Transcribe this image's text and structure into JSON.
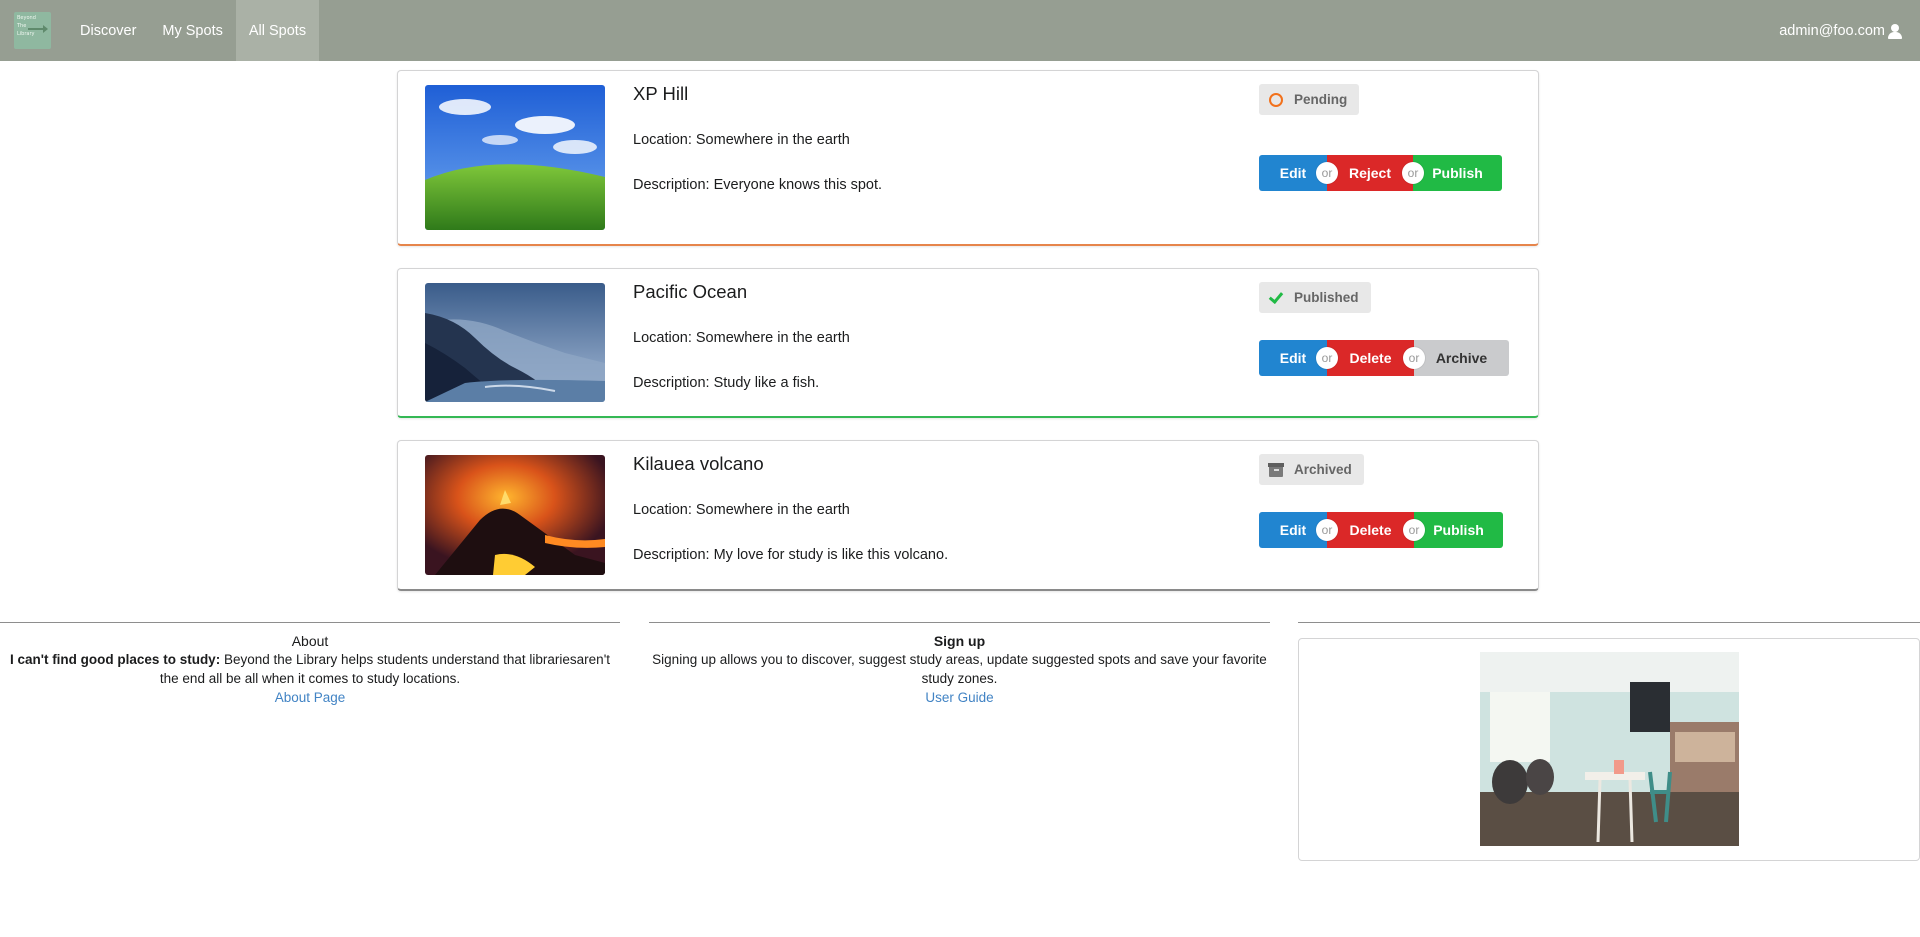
{
  "nav": {
    "logo_lines": [
      "Beyond",
      "The",
      "Library"
    ],
    "items": [
      {
        "label": "Discover"
      },
      {
        "label": "My Spots"
      },
      {
        "label": "All Spots"
      }
    ],
    "user": "admin@foo.com"
  },
  "spots": [
    {
      "title": "XP Hill",
      "location": "Location: Somewhere in the earth",
      "description": "Description: Everyone knows this spot.",
      "status": "Pending",
      "buttons": [
        "Edit",
        "Reject",
        "Publish"
      ],
      "or_label": "or"
    },
    {
      "title": "Pacific Ocean",
      "location": "Location: Somewhere in the earth",
      "description": "Description: Study like a fish.",
      "status": "Published",
      "buttons": [
        "Edit",
        "Delete",
        "Archive"
      ],
      "or_label": "or"
    },
    {
      "title": "Kilauea volcano",
      "location": "Location: Somewhere in the earth",
      "description": "Description: My love for study is like this volcano.",
      "status": "Archived",
      "buttons": [
        "Edit",
        "Delete",
        "Publish"
      ],
      "or_label": "or"
    }
  ],
  "footer": {
    "about": {
      "title": "About",
      "bold": "I can't find good places to study:",
      "text": " Beyond the Library helps students understand that librariesaren't the end all be all when it comes to study locations.",
      "link": "About Page"
    },
    "signup": {
      "title": "Sign up",
      "text": "Signing up allows you to discover, suggest study areas, update suggested spots and save your favorite study zones.",
      "link": "User Guide"
    }
  },
  "colors": {
    "navbar": "#969e92",
    "pending_accent": "#f2711c",
    "published_accent": "#21ba45",
    "archived_accent": "#7a7a7a",
    "edit_button": "#2185d0",
    "danger_button": "#db2828",
    "publish_button": "#21ba45",
    "archive_button": "#cacbcd"
  }
}
